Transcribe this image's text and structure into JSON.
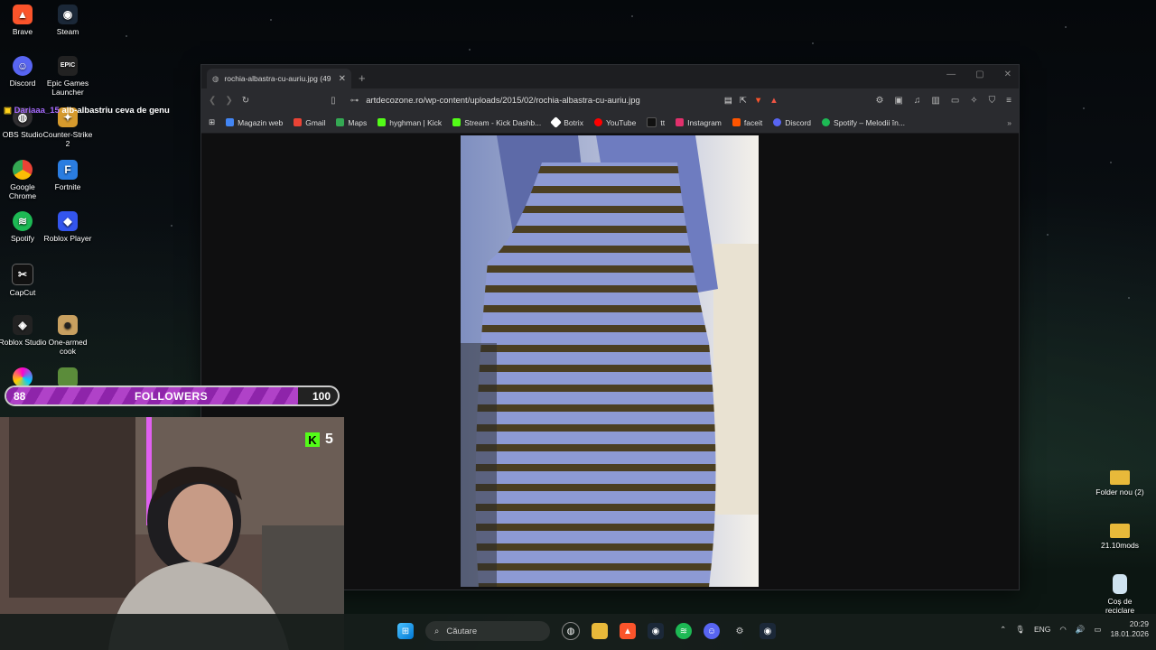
{
  "desktop": {
    "icons_left": [
      {
        "label": "Brave",
        "icon": "brave-icon",
        "color": "#fb542b"
      },
      {
        "label": "Steam",
        "icon": "steam-icon",
        "color": "#1b2838"
      },
      {
        "label": "Discord",
        "icon": "discord-icon",
        "color": "#5865f2"
      },
      {
        "label": "Epic Games Launcher",
        "icon": "epic-icon",
        "color": "#222"
      },
      {
        "label": "OBS Studio",
        "icon": "obs-icon",
        "color": "#302e31"
      },
      {
        "label": "Counter-Strike 2",
        "icon": "cs2-icon",
        "color": "#d69a2d"
      },
      {
        "label": "Google Chrome",
        "icon": "chrome-icon",
        "color": "#4285f4"
      },
      {
        "label": "Fortnite",
        "icon": "fortnite-icon",
        "color": "#2a7de1"
      },
      {
        "label": "Spotify",
        "icon": "spotify-icon",
        "color": "#1db954"
      },
      {
        "label": "Roblox Player",
        "icon": "roblox-icon",
        "color": "#3355ee"
      },
      {
        "label": "CapCut",
        "icon": "capcut-icon",
        "color": "#111"
      },
      {
        "label": "Roblox Studio",
        "icon": "roblox-studio-icon",
        "color": "#222"
      },
      {
        "label": "One-armed cook",
        "icon": "game-icon",
        "color": "#c8a060"
      }
    ],
    "icons_right": [
      {
        "label": "Folder nou (2)",
        "icon": "folder-icon"
      },
      {
        "label": "21.10mods",
        "icon": "folder-icon"
      },
      {
        "label": "Coș de reciclare",
        "icon": "recycle-bin-icon"
      }
    ]
  },
  "chat_message": {
    "user": "Dariaaa_15",
    "text": "alb-albastriu ceva de genu"
  },
  "browser": {
    "tab_title": "rochia-albastra-cu-auriu.jpg (49",
    "url": "artdecozone.ro/wp-content/uploads/2015/02/rochia-albastra-cu-auriu.jpg",
    "bookmarks": [
      {
        "label": "Magazin web",
        "color": "#4285f4"
      },
      {
        "label": "Gmail",
        "color": "#ea4335"
      },
      {
        "label": "Maps",
        "color": "#34a853"
      },
      {
        "label": "hyghman | Kick",
        "color": "#53fc18"
      },
      {
        "label": "Stream - Kick Dashb...",
        "color": "#53fc18"
      },
      {
        "label": "Botrix",
        "color": "#ffffff"
      },
      {
        "label": "YouTube",
        "color": "#ff0000"
      },
      {
        "label": "tt",
        "color": "#111111"
      },
      {
        "label": "Instagram",
        "color": "#e1306c"
      },
      {
        "label": "faceit",
        "color": "#ff5500"
      },
      {
        "label": "Discord",
        "color": "#5865f2"
      },
      {
        "label": "Spotify – Melodii în...",
        "color": "#1db954"
      }
    ]
  },
  "followers_bar": {
    "current": "88",
    "label": "FOLLOWERS",
    "goal": "100",
    "progress": 0.88
  },
  "kick_viewers": "5",
  "taskbar": {
    "search_placeholder": "Căutare",
    "language": "ENG",
    "time": "20:29",
    "date": "18.01.2026"
  }
}
